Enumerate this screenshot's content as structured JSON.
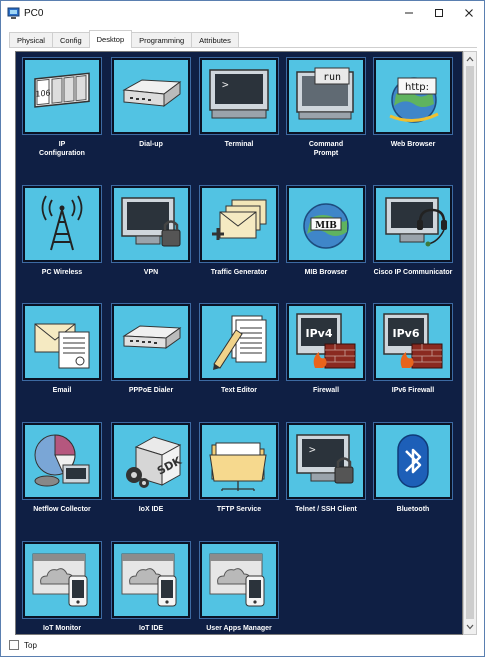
{
  "window": {
    "title": "PC0",
    "controls": {
      "minimize": "minimize-icon",
      "maximize": "maximize-icon",
      "close": "close-icon"
    }
  },
  "tabs": [
    {
      "label": "Physical",
      "active": false
    },
    {
      "label": "Config",
      "active": false
    },
    {
      "label": "Desktop",
      "active": true
    },
    {
      "label": "Programming",
      "active": false
    },
    {
      "label": "Attributes",
      "active": false
    }
  ],
  "apps": [
    {
      "label": "IP\nConfiguration",
      "icon": "ip-config-icon"
    },
    {
      "label": "Dial-up",
      "icon": "modem-icon"
    },
    {
      "label": "Terminal",
      "icon": "terminal-icon"
    },
    {
      "label": "Command\nPrompt",
      "icon": "command-prompt-icon",
      "icon_text": "run"
    },
    {
      "label": "Web Browser",
      "icon": "web-browser-icon",
      "icon_text": "http:"
    },
    {
      "label": "PC Wireless",
      "icon": "wireless-antenna-icon"
    },
    {
      "label": "VPN",
      "icon": "vpn-lock-icon"
    },
    {
      "label": "Traffic Generator",
      "icon": "envelopes-icon"
    },
    {
      "label": "MIB Browser",
      "icon": "mib-globe-icon",
      "icon_text": "MIB"
    },
    {
      "label": "Cisco IP Communicator",
      "icon": "headset-monitor-icon"
    },
    {
      "label": "Email",
      "icon": "email-icon"
    },
    {
      "label": "PPPoE Dialer",
      "icon": "pppoe-modem-icon"
    },
    {
      "label": "Text Editor",
      "icon": "text-editor-icon"
    },
    {
      "label": "Firewall",
      "icon": "firewall-icon",
      "icon_text": "IPv4"
    },
    {
      "label": "IPv6 Firewall",
      "icon": "ipv6-firewall-icon",
      "icon_text": "IPv6"
    },
    {
      "label": "Netflow Collector",
      "icon": "netflow-chart-icon"
    },
    {
      "label": "IoX IDE",
      "icon": "sdk-box-icon",
      "icon_text": "SDK"
    },
    {
      "label": "TFTP Service",
      "icon": "folder-icon"
    },
    {
      "label": "Telnet / SSH Client",
      "icon": "telnet-lock-icon"
    },
    {
      "label": "Bluetooth",
      "icon": "bluetooth-icon"
    },
    {
      "label": "IoT Monitor",
      "icon": "iot-cloud-phone-icon"
    },
    {
      "label": "IoT IDE",
      "icon": "iot-cloud-phone-icon"
    },
    {
      "label": "User Apps Manager",
      "icon": "iot-cloud-phone-icon"
    }
  ],
  "footer": {
    "top_label": "Top",
    "checked": false
  },
  "colors": {
    "tile": "#52c3e3",
    "desktop": "#0f1f44"
  }
}
